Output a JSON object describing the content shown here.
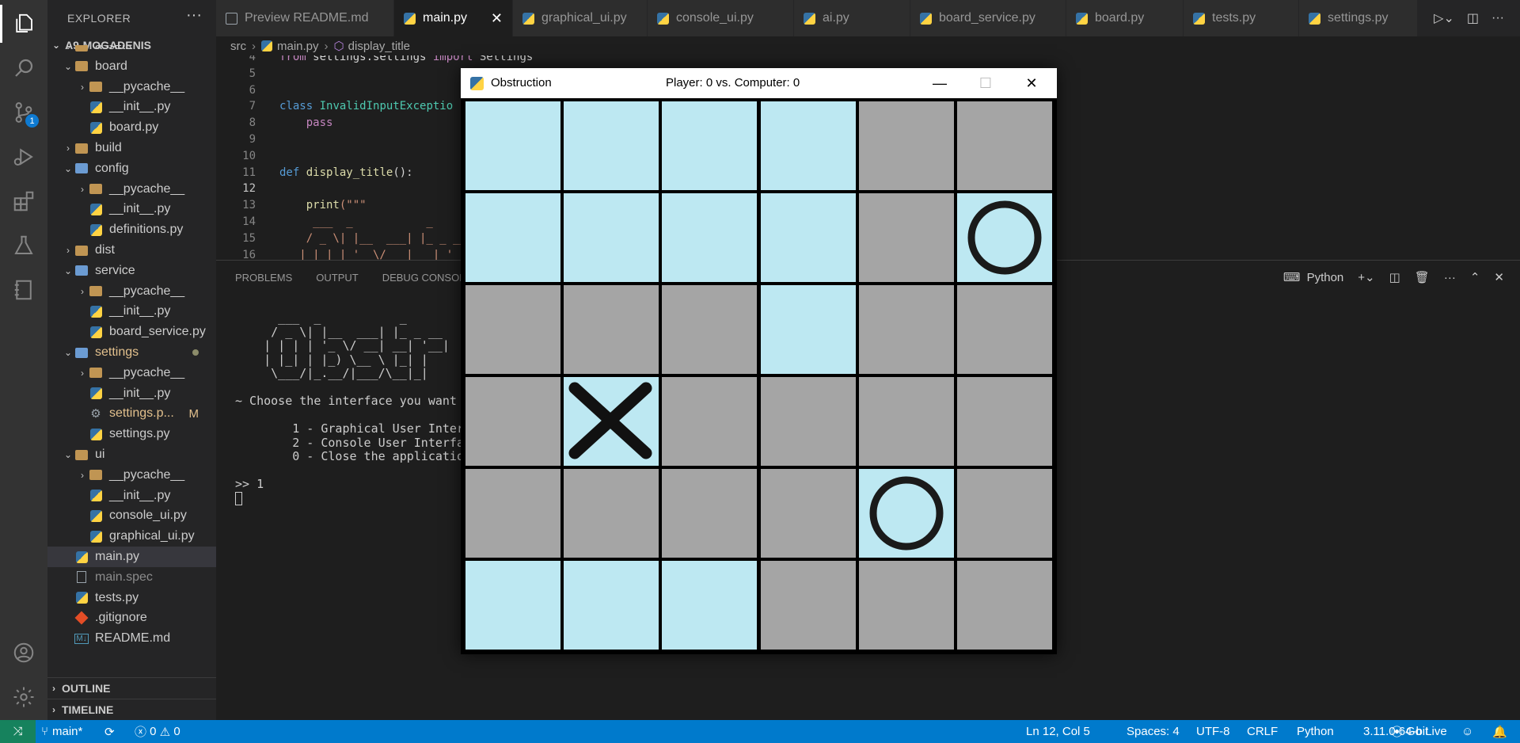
{
  "explorer": {
    "title": "EXPLORER",
    "project": "A9-MOGADENIS",
    "tree": [
      {
        "label": "assets",
        "kind": "folder",
        "depth": 1,
        "open": true
      },
      {
        "label": "board",
        "kind": "folder",
        "depth": 1,
        "open": true
      },
      {
        "label": "__pycache__",
        "kind": "folder",
        "depth": 2,
        "open": false
      },
      {
        "label": "__init__.py",
        "kind": "py",
        "depth": 2
      },
      {
        "label": "board.py",
        "kind": "py",
        "depth": 2
      },
      {
        "label": "build",
        "kind": "folder",
        "depth": 1,
        "open": false
      },
      {
        "label": "config",
        "kind": "folder-blue",
        "depth": 1,
        "open": true
      },
      {
        "label": "__pycache__",
        "kind": "folder",
        "depth": 2,
        "open": false
      },
      {
        "label": "__init__.py",
        "kind": "py",
        "depth": 2
      },
      {
        "label": "definitions.py",
        "kind": "py",
        "depth": 2
      },
      {
        "label": "dist",
        "kind": "folder",
        "depth": 1,
        "open": false
      },
      {
        "label": "service",
        "kind": "folder-blue",
        "depth": 1,
        "open": true
      },
      {
        "label": "__pycache__",
        "kind": "folder",
        "depth": 2,
        "open": false
      },
      {
        "label": "__init__.py",
        "kind": "py",
        "depth": 2
      },
      {
        "label": "board_service.py",
        "kind": "py",
        "depth": 2
      },
      {
        "label": "settings",
        "kind": "folder-blue",
        "depth": 1,
        "open": true,
        "modified_dot": true
      },
      {
        "label": "__pycache__",
        "kind": "folder",
        "depth": 2,
        "open": false
      },
      {
        "label": "__init__.py",
        "kind": "py",
        "depth": 2
      },
      {
        "label": "settings.p...",
        "kind": "gear",
        "depth": 2,
        "modified": "M"
      },
      {
        "label": "settings.py",
        "kind": "py",
        "depth": 2
      },
      {
        "label": "ui",
        "kind": "folder",
        "depth": 1,
        "open": true
      },
      {
        "label": "__pycache__",
        "kind": "folder",
        "depth": 2,
        "open": false
      },
      {
        "label": "__init__.py",
        "kind": "py",
        "depth": 2
      },
      {
        "label": "console_ui.py",
        "kind": "py",
        "depth": 2
      },
      {
        "label": "graphical_ui.py",
        "kind": "py",
        "depth": 2
      },
      {
        "label": "main.py",
        "kind": "py",
        "depth": 1,
        "selected": true
      },
      {
        "label": "main.spec",
        "kind": "file",
        "depth": 1
      },
      {
        "label": "tests.py",
        "kind": "py",
        "depth": 1
      },
      {
        "label": ".gitignore",
        "kind": "git",
        "depth": 1
      },
      {
        "label": "README.md",
        "kind": "md",
        "depth": 1
      }
    ],
    "outline": "OUTLINE",
    "timeline": "TIMELINE"
  },
  "tabs": [
    {
      "label": "Preview README.md",
      "icon": "preview"
    },
    {
      "label": "main.py",
      "icon": "py",
      "active": true
    },
    {
      "label": "graphical_ui.py",
      "icon": "py"
    },
    {
      "label": "console_ui.py",
      "icon": "py"
    },
    {
      "label": "ai.py",
      "icon": "py"
    },
    {
      "label": "board_service.py",
      "icon": "py"
    },
    {
      "label": "board.py",
      "icon": "py"
    },
    {
      "label": "tests.py",
      "icon": "py"
    },
    {
      "label": "settings.py",
      "icon": "py"
    }
  ],
  "breadcrumb": {
    "folder": "src",
    "file": "main.py",
    "symbol": "display_title"
  },
  "editor": {
    "lines": [
      {
        "n": "4",
        "text": "from settings.settings import Settings"
      },
      {
        "n": "5",
        "text": ""
      },
      {
        "n": "6",
        "text": ""
      },
      {
        "n": "7",
        "text": "class InvalidInputExceptio"
      },
      {
        "n": "8",
        "text": "    pass"
      },
      {
        "n": "9",
        "text": ""
      },
      {
        "n": "10",
        "text": ""
      },
      {
        "n": "11",
        "text": "def display_title():"
      },
      {
        "n": "12",
        "text": ""
      },
      {
        "n": "13",
        "text": "    print(\"\"\""
      },
      {
        "n": "14",
        "text": "     ___  _           _"
      },
      {
        "n": "15",
        "text": "    / _ \\| |__  ___| |_ _ __"
      },
      {
        "n": "16",
        "text": "   | | | | '_ \\/ __| __| '__"
      }
    ]
  },
  "panel": {
    "tabs": [
      "PROBLEMS",
      "OUTPUT",
      "DEBUG CONSOLE"
    ],
    "terminal_label": "Python",
    "terminal": [
      "      ___  _           _",
      "     / _ \\| |__  ___| |_ _ __",
      "    | | | | '_ \\/ __| __| '__|",
      "    | |_| | |_) \\__ \\ |_| |",
      "     \\___/|_.__/|___/\\__|_|",
      "",
      "~ Choose the interface you want",
      "",
      "        1 - Graphical User Inter",
      "        2 - Console User Interfa",
      "        0 - Close the applicatio",
      "",
      ">> 1"
    ]
  },
  "status": {
    "branch": "main*",
    "errors": "0",
    "warnings": "0",
    "position": "Ln 12, Col 5",
    "spaces": "Spaces: 4",
    "encoding": "UTF-8",
    "eol": "CRLF",
    "language": "Python",
    "interpreter": "3.11.0 64-bit",
    "golive": "Go Live"
  },
  "game": {
    "title": "Obstruction",
    "score": "Player: 0 vs. Computer: 0",
    "colors": {
      "free": "#bde8f2",
      "blocked": "#a5a5a5"
    },
    "board": [
      [
        "free",
        "free",
        "free",
        "free",
        "blocked",
        "blocked"
      ],
      [
        "free",
        "free",
        "free",
        "free",
        "blocked",
        "O"
      ],
      [
        "blocked",
        "blocked",
        "blocked",
        "free",
        "blocked",
        "blocked"
      ],
      [
        "blocked",
        "X",
        "blocked",
        "blocked",
        "blocked",
        "blocked"
      ],
      [
        "blocked",
        "blocked",
        "blocked",
        "blocked",
        "O",
        "blocked"
      ],
      [
        "free",
        "free",
        "free",
        "blocked",
        "blocked",
        "blocked"
      ]
    ]
  }
}
